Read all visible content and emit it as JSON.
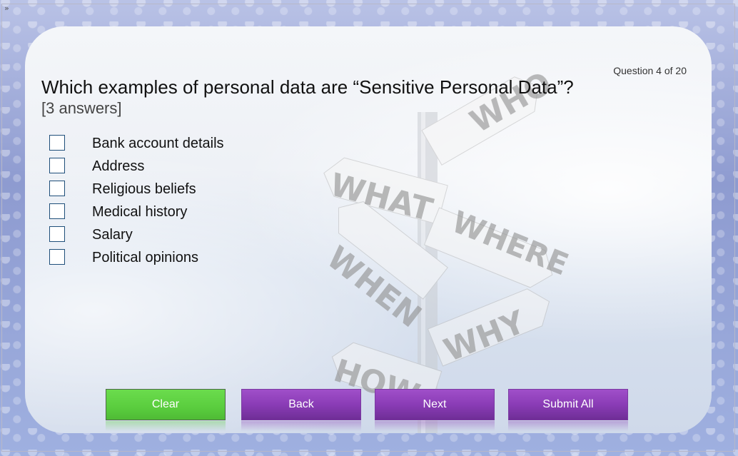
{
  "window": {
    "expand_glyph": "»"
  },
  "quiz": {
    "counter": "Question 4 of 20",
    "question": "Which examples of personal data are “Sensitive Personal Data”?",
    "answer_hint": "[3 answers]",
    "options": [
      {
        "label": "Bank account details",
        "checked": false
      },
      {
        "label": "Address",
        "checked": false
      },
      {
        "label": "Religious beliefs",
        "checked": false
      },
      {
        "label": "Medical history",
        "checked": false
      },
      {
        "label": "Salary",
        "checked": false
      },
      {
        "label": "Political opinions",
        "checked": false
      }
    ]
  },
  "illustration": {
    "signs": [
      "WHO",
      "WHAT",
      "WHERE",
      "WHEN",
      "WHY",
      "HOW"
    ]
  },
  "buttons": {
    "clear": "Clear",
    "back": "Back",
    "next": "Next",
    "submit_all": "Submit All"
  },
  "colors": {
    "clear_button": "#5acd3e",
    "nav_button": "#8a3cb6"
  }
}
